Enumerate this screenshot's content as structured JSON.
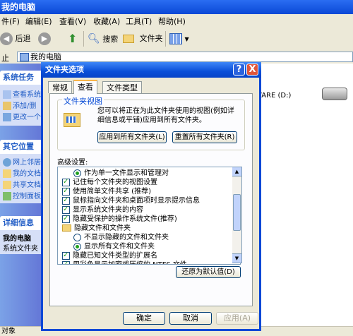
{
  "window": {
    "title": "我的电脑"
  },
  "menu": [
    "件(F)",
    "编辑(E)",
    "查看(V)",
    "收藏(A)",
    "工具(T)",
    "帮助(H)"
  ],
  "toolbar": {
    "back_label": "后退",
    "search_label": "搜索",
    "folders_label": "文件夹"
  },
  "address": {
    "label": "止",
    "value": "我的电脑"
  },
  "left_pane": {
    "system_tasks": {
      "title": "系统任务",
      "items": [
        "查看系统",
        "添加/删",
        "更改一个"
      ]
    },
    "other_places": {
      "title": "其它位置",
      "items": [
        "网上邻居",
        "我的文档",
        "共享文档",
        "控制面板"
      ]
    },
    "details": {
      "title": "详细信息",
      "name": "我的电脑",
      "desc": "系统文件夹"
    }
  },
  "main": {
    "drive_label": "VARE (D:)"
  },
  "status": {
    "text": "对象"
  },
  "dialog": {
    "title": "文件夹选项",
    "help_btn": "?",
    "close_btn": "X",
    "tabs": [
      "常规",
      "查看",
      "文件类型"
    ],
    "active_tab": "查看",
    "folder_views": {
      "legend": "文件夹视图",
      "desc": "您可以将正在为此文件夹使用的视图(例如详细信息或平铺)应用到所有文件夹。",
      "apply_btn": "应用到所有文件夹(L)",
      "reset_btn": "重置所有文件夹(R)"
    },
    "advanced": {
      "label": "高级设置:",
      "rows": [
        {
          "type": "radio",
          "checked": true,
          "indent": 1,
          "text": "作为单一文件显示和管理对"
        },
        {
          "type": "check",
          "checked": true,
          "indent": 0,
          "text": "记住每个文件夹的视图设置"
        },
        {
          "type": "check",
          "checked": true,
          "indent": 0,
          "text": "使用简单文件共享 (推荐)"
        },
        {
          "type": "check",
          "checked": true,
          "indent": 0,
          "text": "鼠标指向文件夹和桌面项时显示提示信息"
        },
        {
          "type": "check",
          "checked": true,
          "indent": 0,
          "text": "显示系统文件夹的内容"
        },
        {
          "type": "check",
          "checked": true,
          "indent": 0,
          "text": "隐藏受保护的操作系统文件(推荐)"
        },
        {
          "type": "folder",
          "checked": false,
          "indent": 0,
          "text": "隐藏文件和文件夹"
        },
        {
          "type": "radio",
          "checked": false,
          "indent": 1,
          "text": "不显示隐藏的文件和文件夹"
        },
        {
          "type": "radio",
          "checked": true,
          "indent": 1,
          "text": "显示所有文件和文件夹"
        },
        {
          "type": "check",
          "checked": true,
          "indent": 0,
          "text": "隐藏已知文件类型的扩展名"
        },
        {
          "type": "check",
          "checked": true,
          "indent": 0,
          "text": "用彩色显示加密或压缩的 NTFS 文件"
        }
      ]
    },
    "restore_btn": "还原为默认值(D)",
    "ok_btn": "确定",
    "cancel_btn": "取消",
    "apply_btn": "应用(A)"
  }
}
